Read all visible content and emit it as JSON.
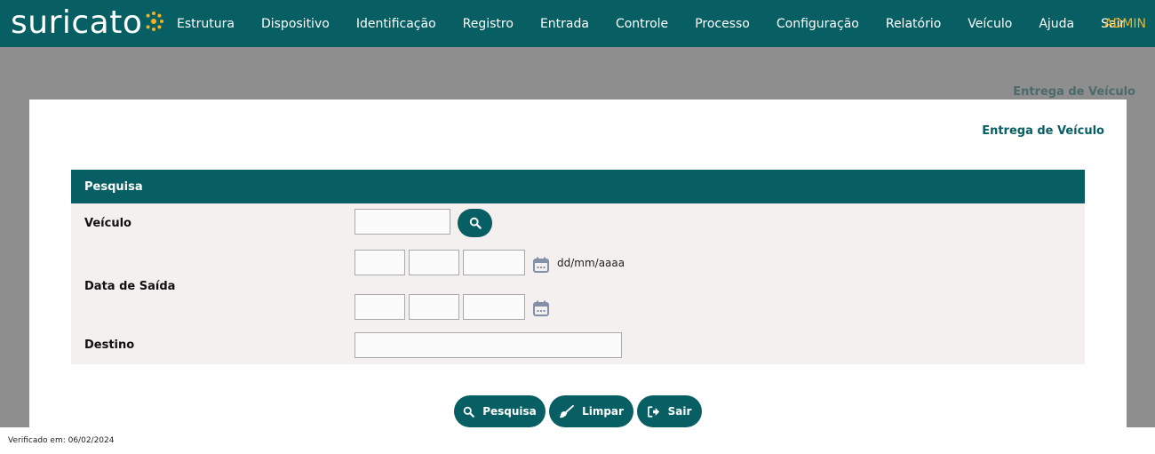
{
  "brand": {
    "name": "suricato"
  },
  "nav": {
    "items": [
      {
        "label": "Estrutura"
      },
      {
        "label": "Dispositivo"
      },
      {
        "label": "Identificação"
      },
      {
        "label": "Registro"
      },
      {
        "label": "Entrada"
      },
      {
        "label": "Controle"
      },
      {
        "label": "Processo"
      },
      {
        "label": "Configuração"
      },
      {
        "label": "Relatório"
      },
      {
        "label": "Veículo"
      },
      {
        "label": "Ajuda"
      },
      {
        "label": "Sair"
      }
    ],
    "user": "ADMIN"
  },
  "page": {
    "breadcrumb": "Entrega de Veículo",
    "title": "Entrega de Veículo"
  },
  "form": {
    "header": "Pesquisa",
    "veiculo_label": "Veículo",
    "veiculo_value": "",
    "data_saida_label": "Data de Saída",
    "date_from": {
      "day": "",
      "month": "",
      "year": ""
    },
    "date_to": {
      "day": "",
      "month": "",
      "year": ""
    },
    "date_hint": "dd/mm/aaaa",
    "destino_label": "Destino",
    "destino_value": ""
  },
  "actions": {
    "search": "Pesquisa",
    "clear": "Limpar",
    "exit": "Sair"
  },
  "footer": {
    "verified": "Verificado em: 06/02/2024"
  },
  "colors": {
    "primary": "#075f63",
    "accent": "#f5b324",
    "backdrop": "#8e8e8e",
    "form_bg": "#f4f0ef"
  }
}
